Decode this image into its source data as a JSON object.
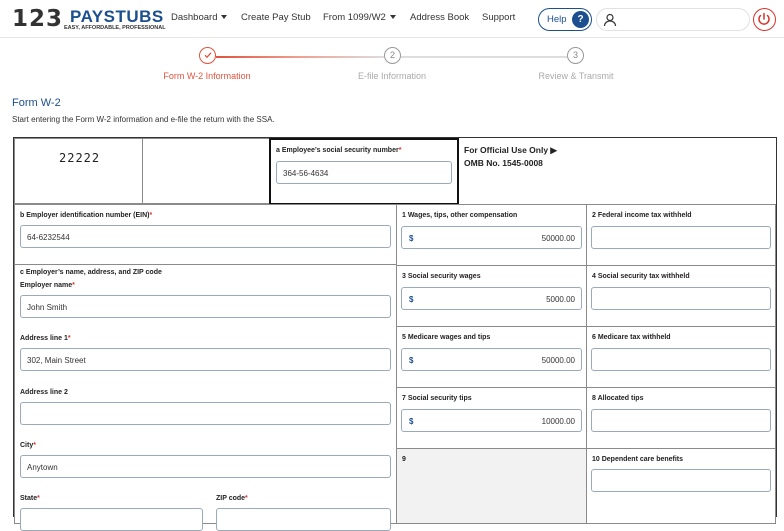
{
  "brand": {
    "num": "123",
    "name": "PAYSTUBS",
    "tagline": "EASY, AFFORDABLE, PROFESSIONAL"
  },
  "colors": {
    "brand_blue": "#1c4f8f",
    "accent_red": "#e0533d",
    "power_red": "#d9342b"
  },
  "nav": {
    "dashboard": "Dashboard",
    "create_pay_stub": "Create Pay Stub",
    "form_1099": "From 1099/W2",
    "address_book": "Address Book",
    "support": "Support",
    "help": "Help",
    "help_icon": "?"
  },
  "icons": {
    "user": "user-icon",
    "power": "power-icon",
    "check": "check-icon",
    "dropdown": "chevron-down-icon"
  },
  "steps": [
    {
      "num": "1",
      "label": "Form W-2 Information",
      "active": true
    },
    {
      "num": "2",
      "label": "E-file Information",
      "active": false
    },
    {
      "num": "3",
      "label": "Review & Transmit",
      "active": false
    }
  ],
  "form": {
    "title": "Form W-2",
    "subtitle": "Start entering the Form W-2 information and e-file the return with the SSA.",
    "control_code": "22222",
    "official": {
      "line1": "For Official Use Only ▶",
      "line2": "OMB No. 1545-0008"
    },
    "ssn": {
      "label": "a Employee’s social security number",
      "value": "364-56-4634"
    },
    "ein": {
      "label": "b Employer identification number (EIN)",
      "value": "64-6232544"
    },
    "employer_section": "c  Employer’s name, address, and ZIP code",
    "employer_name": {
      "label": "Employer name",
      "value": "John Smith"
    },
    "address1": {
      "label": "Address line 1",
      "value": "302, Main Street"
    },
    "address2": {
      "label": "Address line 2",
      "value": ""
    },
    "city": {
      "label": "City",
      "value": "Anytown"
    },
    "state": {
      "label": "State"
    },
    "zip": {
      "label": "ZIP code"
    },
    "currency": "$",
    "boxes": {
      "b1": {
        "label": "1 Wages, tips, other compensation",
        "value": "50000.00"
      },
      "b2": {
        "label": "2 Federal income tax withheld",
        "value": ""
      },
      "b3": {
        "label": "3 Social security wages",
        "value": "5000.00"
      },
      "b4": {
        "label": "4 Social security tax withheld",
        "value": ""
      },
      "b5": {
        "label": "5 Medicare wages and tips",
        "value": "50000.00"
      },
      "b6": {
        "label": "6 Medicare tax withheld",
        "value": ""
      },
      "b7": {
        "label": "7 Social security tips",
        "value": "10000.00"
      },
      "b8": {
        "label": "8 Allocated tips",
        "value": ""
      },
      "b9": {
        "label": "9"
      },
      "b10": {
        "label": "10 Dependent care benefits",
        "value": ""
      }
    }
  }
}
